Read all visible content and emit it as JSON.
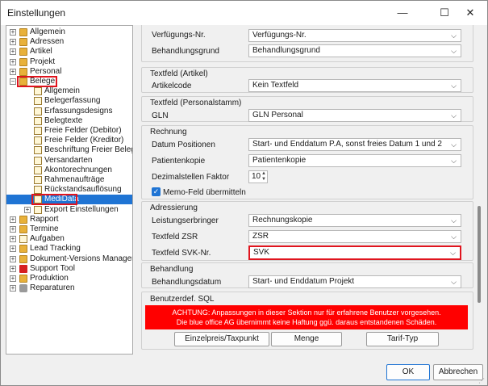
{
  "window": {
    "title": "Einstellungen",
    "controls": {
      "minimize": "—",
      "maximize": "☐",
      "close": "✕"
    }
  },
  "tree": {
    "expanded_glyph": "−",
    "collapsed_glyph": "+",
    "top_items": [
      "Allgemein",
      "Adressen",
      "Artikel",
      "Projekt",
      "Personal"
    ],
    "belege_label": "Belege",
    "belege_children": [
      "Allgemein",
      "Belegerfassung",
      "Erfassungsdesigns",
      "Belegtexte",
      "Freie Felder (Debitor)",
      "Freie Felder (Kreditor)",
      "Beschriftung Freier Beleg",
      "Versandarten",
      "Akontorechnungen",
      "Rahmenaufträge",
      "Rückstandsauflösung",
      "MediData",
      "Export Einstellungen"
    ],
    "selected": "MediData",
    "bottom_items": [
      "Rapport",
      "Termine",
      "Aufgaben",
      "Lead Tracking",
      "Dokument-Versions Manager",
      "Support Tool",
      "Produktion",
      "Reparaturen"
    ]
  },
  "form": {
    "top": {
      "verfuegungs_label": "Verfügungs-Nr.",
      "verfuegungs_value": "Verfügungs-Nr.",
      "behandlungsgrund_label": "Behandlungsgrund",
      "behandlungsgrund_value": "Behandlungsgrund"
    },
    "textfeld_artikel": {
      "title": "Textfeld (Artikel)",
      "artikelcode_label": "Artikelcode",
      "artikelcode_value": "Kein Textfeld"
    },
    "textfeld_personal": {
      "title": "Textfeld (Personalstamm)",
      "gln_label": "GLN",
      "gln_value": "GLN Personal"
    },
    "rechnung": {
      "title": "Rechnung",
      "datum_label": "Datum Positionen",
      "datum_value": "Start- und Enddatum P.A, sonst freies Datum 1 und 2",
      "patientenkopie_label": "Patientenkopie",
      "patientenkopie_value": "Patientenkopie",
      "dezimal_label": "Dezimalstellen Faktor",
      "dezimal_value": "10",
      "memo_label": "Memo-Feld übermitteln",
      "memo_checked": true
    },
    "adressierung": {
      "title": "Adressierung",
      "leistung_label": "Leistungserbringer",
      "leistung_value": "Rechnungskopie",
      "zsr_label": "Textfeld ZSR",
      "zsr_value": "ZSR",
      "svk_label": "Textfeld SVK-Nr.",
      "svk_value": "SVK"
    },
    "behandlung": {
      "title": "Behandlung",
      "datum_label": "Behandlungsdatum",
      "datum_value": "Start- und Enddatum Projekt"
    },
    "sql": {
      "title": "Benutzerdef. SQL",
      "warning_line1": "ACHTUNG: Anpassungen in dieser Sektion nur für erfahrene Benutzer vorgesehen.",
      "warning_line2": "Die blue office AG übernimmt keine Haftung ggü. daraus entstandenen Schäden.",
      "buttons": [
        "Einzelpreis/Taxpunkt",
        "Menge",
        "Tarif-Typ"
      ]
    }
  },
  "footer": {
    "ok": "OK",
    "cancel": "Abbrechen"
  },
  "colors": {
    "selection": "#1f74d4",
    "highlight_box": "#e0141e",
    "warning_bg": "#ff0000"
  }
}
